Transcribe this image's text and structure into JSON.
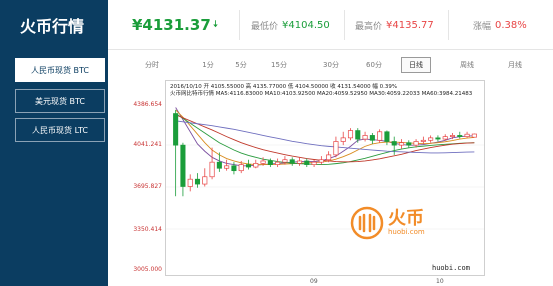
{
  "app": {
    "title": "火币行情"
  },
  "sidebar": {
    "items": [
      {
        "label": "人民币现货 BTC",
        "active": true
      },
      {
        "label": "美元现货 BTC",
        "active": false
      },
      {
        "label": "人民币现货 LTC",
        "active": false
      }
    ]
  },
  "header": {
    "price": "¥4131.37",
    "price_direction_icon": "arrow-down-icon",
    "low_label": "最低价",
    "low_value": "¥4104.50",
    "high_label": "最高价",
    "high_value": "¥4135.77",
    "change_label": "涨幅",
    "change_value": "0.38%"
  },
  "tabs": [
    {
      "label": "分时"
    },
    {
      "label": "1分"
    },
    {
      "label": "5分"
    },
    {
      "label": "15分"
    },
    {
      "label": "30分"
    },
    {
      "label": "60分"
    },
    {
      "label": "日线",
      "active": true
    },
    {
      "label": "周线"
    },
    {
      "label": "月线"
    }
  ],
  "chart": {
    "info_line1": "2016/10/10 开 4105.55000 高 4135.77000 低 4104.50000 收 4131.54000 幅 0.39%",
    "info_line2": "火币网比特币行情 MA5:4116.83000 MA10:4103.92500 MA20:4059.52950 MA30:4059.22033 MA60:3984.21483",
    "watermark_url": "huobi.com",
    "logo_cn": "火币",
    "logo_url": "huobi.com"
  },
  "colors": {
    "up": "#e84545",
    "down": "#1a9d3a",
    "ma5": "#7b4fa0",
    "ma10": "#d98c1f",
    "ma20": "#2b9c3f",
    "ma30": "#c0392b",
    "ma60": "#6f6fbf",
    "sidebar_bg": "#0b3d61",
    "brand_orange": "#f28c28"
  },
  "chart_data": {
    "type": "candlestick",
    "y_ticks": [
      "4386.654",
      "4041.241",
      "3695.827",
      "3350.414",
      "3005.000"
    ],
    "ylim": [
      3005.0,
      4386.654
    ],
    "x_ticks": [
      "09",
      "10"
    ],
    "series": [
      {
        "name": "MA5",
        "values": [
          4350,
          4250,
          4150,
          4050,
          3990,
          3940,
          3910,
          3890,
          3880,
          3870,
          3870,
          3875,
          3880,
          3885,
          3890,
          3895,
          3900,
          3905,
          3905,
          3905,
          3910,
          3930,
          3950,
          3990,
          4030,
          4080,
          4090,
          4085,
          4080,
          4070,
          4055,
          4045,
          4040,
          4040,
          4045,
          4055,
          4065,
          4080,
          4100,
          4110,
          4115,
          4117
        ]
      },
      {
        "name": "MA10",
        "values": [
          4330,
          4270,
          4200,
          4130,
          4060,
          4000,
          3960,
          3930,
          3910,
          3895,
          3885,
          3880,
          3880,
          3880,
          3882,
          3885,
          3888,
          3892,
          3895,
          3898,
          3900,
          3910,
          3925,
          3945,
          3970,
          4000,
          4030,
          4050,
          4060,
          4065,
          4065,
          4062,
          4058,
          4055,
          4052,
          4055,
          4060,
          4068,
          4078,
          4090,
          4098,
          4104
        ]
      },
      {
        "name": "MA20",
        "values": [
          4300,
          4260,
          4220,
          4180,
          4140,
          4100,
          4060,
          4030,
          4000,
          3975,
          3955,
          3940,
          3925,
          3915,
          3905,
          3898,
          3892,
          3888,
          3885,
          3882,
          3880,
          3882,
          3888,
          3895,
          3905,
          3918,
          3932,
          3948,
          3965,
          3980,
          3995,
          4008,
          4018,
          4026,
          4032,
          4038,
          4043,
          4047,
          4051,
          4055,
          4058,
          4060
        ]
      },
      {
        "name": "MA30",
        "values": [
          4290,
          4265,
          4240,
          4215,
          4190,
          4165,
          4138,
          4110,
          4085,
          4060,
          4040,
          4020,
          4003,
          3988,
          3975,
          3962,
          3950,
          3940,
          3930,
          3922,
          3915,
          3910,
          3905,
          3903,
          3903,
          3905,
          3910,
          3918,
          3928,
          3940,
          3952,
          3965,
          3980,
          3995,
          4008,
          4020,
          4030,
          4040,
          4048,
          4053,
          4057,
          4059
        ]
      },
      {
        "name": "MA60",
        "values": [
          4240,
          4232,
          4224,
          4216,
          4208,
          4200,
          4190,
          4180,
          4170,
          4158,
          4146,
          4133,
          4120,
          4108,
          4096,
          4084,
          4072,
          4062,
          4052,
          4044,
          4036,
          4030,
          4025,
          4020,
          4015,
          4010,
          4005,
          4000,
          3995,
          3990,
          3987,
          3985,
          3982,
          3980,
          3978,
          3976,
          3976,
          3977,
          3979,
          3981,
          3983,
          3984
        ]
      }
    ],
    "candles": [
      {
        "o": 4300,
        "c": 4040,
        "h": 4330,
        "l": 3620
      },
      {
        "o": 4040,
        "c": 3700,
        "h": 4060,
        "l": 3620
      },
      {
        "o": 3700,
        "c": 3760,
        "h": 3800,
        "l": 3660
      },
      {
        "o": 3760,
        "c": 3720,
        "h": 3810,
        "l": 3690
      },
      {
        "o": 3720,
        "c": 3780,
        "h": 3850,
        "l": 3700
      },
      {
        "o": 3780,
        "c": 3900,
        "h": 4020,
        "l": 3760
      },
      {
        "o": 3900,
        "c": 3850,
        "h": 3980,
        "l": 3820
      },
      {
        "o": 3850,
        "c": 3870,
        "h": 3920,
        "l": 3830
      },
      {
        "o": 3870,
        "c": 3830,
        "h": 3900,
        "l": 3800
      },
      {
        "o": 3830,
        "c": 3880,
        "h": 3910,
        "l": 3810
      },
      {
        "o": 3880,
        "c": 3860,
        "h": 3920,
        "l": 3840
      },
      {
        "o": 3860,
        "c": 3890,
        "h": 3920,
        "l": 3850
      },
      {
        "o": 3890,
        "c": 3910,
        "h": 3940,
        "l": 3870
      },
      {
        "o": 3910,
        "c": 3880,
        "h": 3930,
        "l": 3860
      },
      {
        "o": 3880,
        "c": 3900,
        "h": 3930,
        "l": 3860
      },
      {
        "o": 3900,
        "c": 3920,
        "h": 3950,
        "l": 3880
      },
      {
        "o": 3920,
        "c": 3890,
        "h": 3940,
        "l": 3870
      },
      {
        "o": 3890,
        "c": 3910,
        "h": 3940,
        "l": 3870
      },
      {
        "o": 3910,
        "c": 3880,
        "h": 3930,
        "l": 3860
      },
      {
        "o": 3880,
        "c": 3900,
        "h": 3920,
        "l": 3860
      },
      {
        "o": 3900,
        "c": 3920,
        "h": 3950,
        "l": 3880
      },
      {
        "o": 3920,
        "c": 3960,
        "h": 3990,
        "l": 3900
      },
      {
        "o": 3960,
        "c": 4070,
        "h": 4110,
        "l": 3940
      },
      {
        "o": 4070,
        "c": 4100,
        "h": 4150,
        "l": 4040
      },
      {
        "o": 4100,
        "c": 4160,
        "h": 4180,
        "l": 4080
      },
      {
        "o": 4160,
        "c": 4090,
        "h": 4180,
        "l": 4060
      },
      {
        "o": 4090,
        "c": 4120,
        "h": 4150,
        "l": 4070
      },
      {
        "o": 4120,
        "c": 4080,
        "h": 4140,
        "l": 4050
      },
      {
        "o": 4080,
        "c": 4150,
        "h": 4170,
        "l": 4060
      },
      {
        "o": 4150,
        "c": 4070,
        "h": 4160,
        "l": 4040
      },
      {
        "o": 4070,
        "c": 4040,
        "h": 4110,
        "l": 3960
      },
      {
        "o": 4040,
        "c": 4060,
        "h": 4090,
        "l": 4010
      },
      {
        "o": 4060,
        "c": 4040,
        "h": 4080,
        "l": 4020
      },
      {
        "o": 4040,
        "c": 4070,
        "h": 4090,
        "l": 4020
      },
      {
        "o": 4070,
        "c": 4080,
        "h": 4110,
        "l": 4050
      },
      {
        "o": 4080,
        "c": 4100,
        "h": 4120,
        "l": 4060
      },
      {
        "o": 4100,
        "c": 4090,
        "h": 4120,
        "l": 4070
      },
      {
        "o": 4090,
        "c": 4110,
        "h": 4130,
        "l": 4080
      },
      {
        "o": 4110,
        "c": 4120,
        "h": 4140,
        "l": 4090
      },
      {
        "o": 4120,
        "c": 4110,
        "h": 4150,
        "l": 4095
      },
      {
        "o": 4110,
        "c": 4130,
        "h": 4150,
        "l": 4100
      },
      {
        "o": 4105.55,
        "c": 4131.54,
        "h": 4135.77,
        "l": 4104.5
      }
    ]
  }
}
